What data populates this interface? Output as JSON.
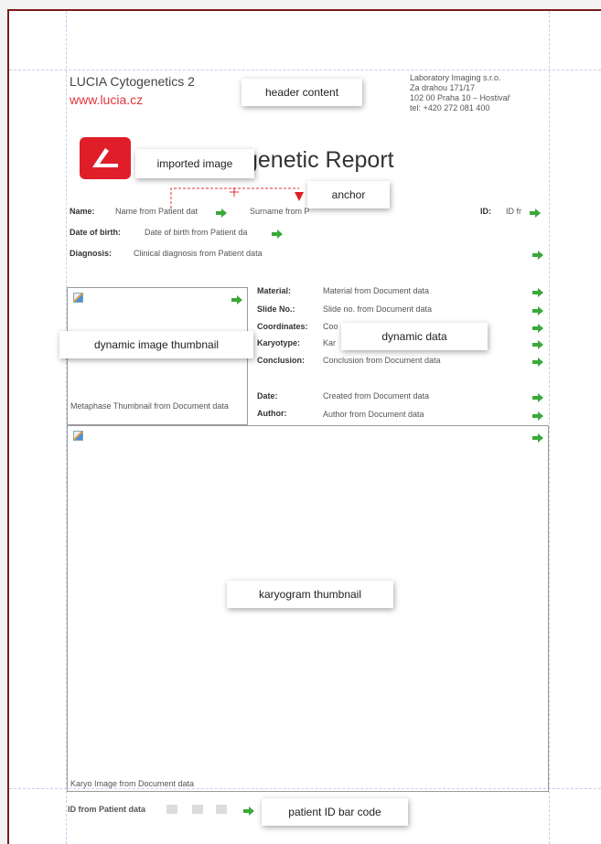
{
  "header": {
    "company": "LUCIA Cytogenetics 2",
    "url": "www.lucia.cz",
    "address_lines": [
      "Laboratory Imaging s.r.o.",
      "Za drahou 171/17",
      "102 00 Praha 10 – Hostivař",
      "tel: +420 272 081 400"
    ]
  },
  "report": {
    "title": "genetic Report"
  },
  "patient": {
    "name_label": "Name:",
    "name_value": "Name from Patient dat",
    "surname_value": "Surname from P",
    "id_label": "ID:",
    "id_value": "ID fr",
    "dob_label": "Date of birth:",
    "dob_value": "Date of birth from Patient da",
    "diagnosis_label": "Diagnosis:",
    "diagnosis_value": "Clinical diagnosis from Patient data"
  },
  "document": {
    "material_label": "Material:",
    "material_value": "Material from Document data",
    "slide_label": "Slide No.:",
    "slide_value": "Slide no. from Document data",
    "coords_label": "Coordinates:",
    "coords_value": "Coo",
    "karyotype_label": "Karyotype:",
    "karyotype_value": "Kar",
    "conclusion_label": "Conclusion:",
    "conclusion_value": "Conclusion from Document data",
    "date_label": "Date:",
    "date_value": "Created from Document data",
    "author_label": "Author:",
    "author_value": "Author from Document data",
    "metaphase_caption": "Metaphase Thumbnail from Document data",
    "karyo_caption": "Karyo Image from Document data"
  },
  "footer": {
    "barcode_text": "ID from Patient data"
  },
  "callouts": {
    "header_content": "header content",
    "imported_image": "imported image",
    "anchor": "anchor",
    "dynamic_image_thumbnail": "dynamic image thumbnail",
    "dynamic_data": "dynamic data",
    "karyogram_thumbnail": "karyogram thumbnail",
    "patient_id_bar_code": "patient ID bar code"
  },
  "colors": {
    "accent_red": "#e01e2a",
    "arrow_green": "#3aa83a",
    "frame": "#7a1b1b"
  },
  "icons": {
    "field_arrow": "green-arrow-icon",
    "image_placeholder": "image-placeholder-icon"
  }
}
